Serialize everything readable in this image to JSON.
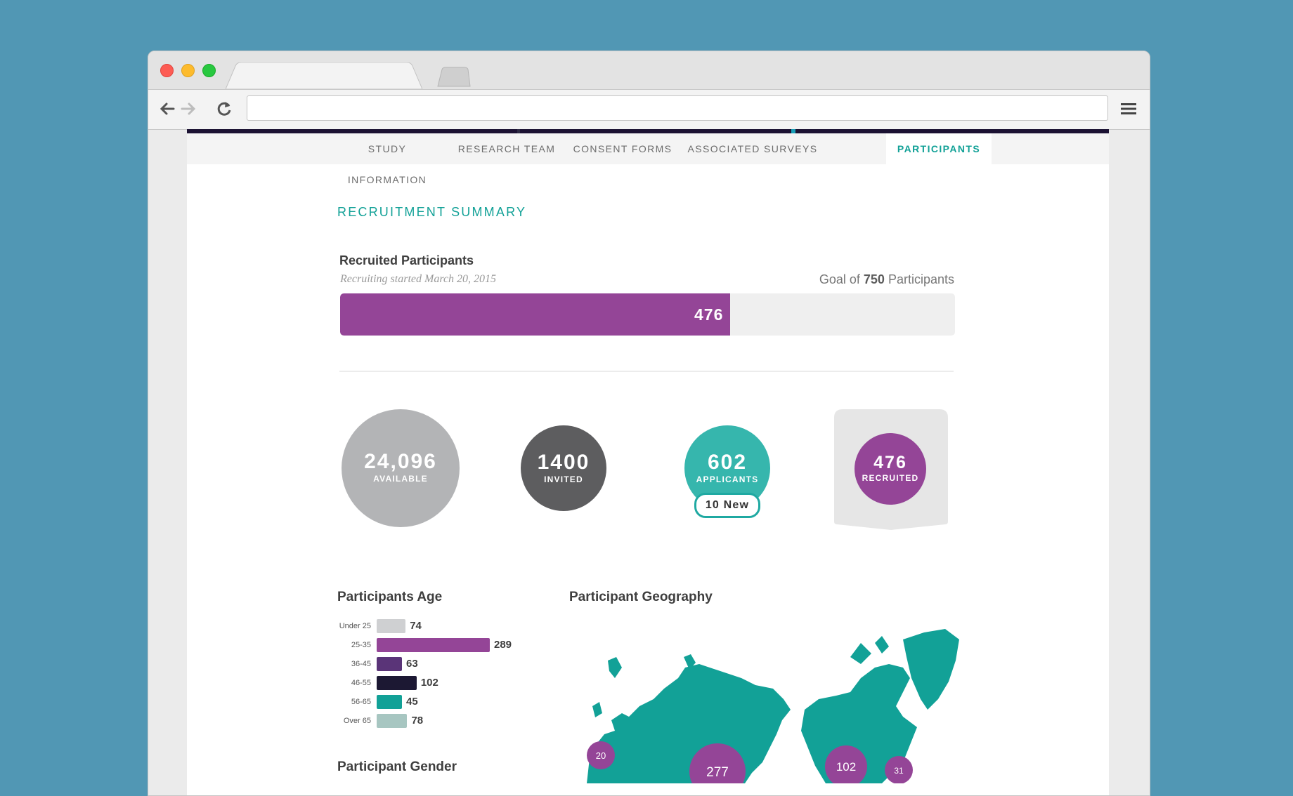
{
  "browser": {
    "url": ""
  },
  "tabs": [
    {
      "label": "STUDY INFORMATION"
    },
    {
      "label": "RESEARCH TEAM"
    },
    {
      "label": "CONSENT FORMS"
    },
    {
      "label": "ASSOCIATED SURVEYS"
    },
    {
      "label": "PARTICIPANTS",
      "active": true
    }
  ],
  "summary": {
    "section_title": "RECRUITMENT SUMMARY",
    "title": "Recruited Participants",
    "subtitle": "Recruiting started March 20, 2015",
    "goal_prefix": "Goal of ",
    "goal_value": "750",
    "goal_suffix": " Participants",
    "recruited_value": "476",
    "recruited_fraction": 0.6347
  },
  "stats": [
    {
      "value": "24,096",
      "label": "AVAILABLE",
      "color": "#b3b4b6"
    },
    {
      "value": "1400",
      "label": "INVITED",
      "color": "#5d5d5f"
    },
    {
      "value": "602",
      "label": "APPLICANTS",
      "color": "#36b6ad",
      "badge": "10 New"
    },
    {
      "value": "476",
      "label": "RECRUITED",
      "color": "#944597"
    }
  ],
  "age": {
    "title": "Participants Age",
    "rows": [
      {
        "label": "Under 25",
        "value": "74",
        "color": "#cfd0d2"
      },
      {
        "label": "25-35",
        "value": "289",
        "color": "#944597"
      },
      {
        "label": "36-45",
        "value": "63",
        "color": "#5a3478"
      },
      {
        "label": "46-55",
        "value": "102",
        "color": "#1c1833"
      },
      {
        "label": "56-65",
        "value": "45",
        "color": "#12a197"
      },
      {
        "label": "Over 65",
        "value": "78",
        "color": "#a7c6c1"
      }
    ]
  },
  "geography": {
    "title": "Participant Geography",
    "clusters": [
      {
        "value": "20",
        "color": "#944597"
      },
      {
        "value": "277",
        "color": "#944597"
      },
      {
        "value": "102",
        "color": "#944597"
      },
      {
        "value": "31",
        "color": "#944597"
      }
    ],
    "land_color": "#12a197"
  },
  "gender": {
    "title": "Participant Gender"
  }
}
